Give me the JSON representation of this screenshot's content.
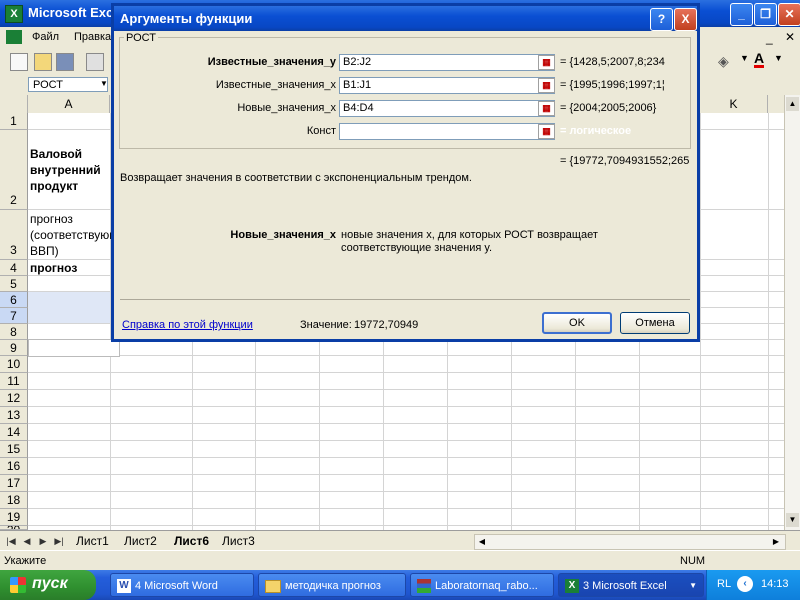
{
  "excel": {
    "title": "Microsoft Excel",
    "app_icon": "X",
    "menu": [
      "Файл",
      "Правка"
    ],
    "name_box": "РОСТ",
    "columns": [
      "A",
      "K"
    ],
    "rows": [
      "1",
      "2",
      "3",
      "4",
      "5",
      "6",
      "7",
      "8",
      "9",
      "10",
      "11",
      "12",
      "13",
      "14",
      "15",
      "16",
      "17",
      "18",
      "19",
      "20"
    ],
    "cells": {
      "a2": "Валовой внутренний продукт",
      "a3": "прогноз (соответствующий ВВП)",
      "a4": "прогноз"
    },
    "sheet_tabs": [
      "Лист1",
      "Лист2",
      "Лист6",
      "Лист3"
    ],
    "active_sheet": "Лист6",
    "status": {
      "mode": "Укажите",
      "num": "NUM"
    }
  },
  "dialog": {
    "title": "Аргументы функции",
    "group": "РОСТ",
    "args": [
      {
        "label": "Известные_значения_y",
        "value": "B2:J2",
        "result": "= {1428,5;2007,8;234",
        "bold": true
      },
      {
        "label": "Известные_значения_x",
        "value": "B1:J1",
        "result": "= {1995;1996;1997;1¦"
      },
      {
        "label": "Новые_значения_x",
        "value": "B4:D4",
        "result": "= {2004;2005;2006}"
      },
      {
        "label": "Конст",
        "value": "",
        "result": "= логическое"
      }
    ],
    "formula_result": "= {19772,7094931552;265",
    "description": "Возвращает значения в соответствии с экспоненциальным трендом.",
    "arg_help_name": "Новые_значения_x",
    "arg_help_text_1": "новые значения x, для которых РОСТ возвращает",
    "arg_help_text_2": "соответствующие значения y.",
    "help_link": "Справка по этой функции",
    "value_label": "Значение:",
    "value": "19772,70949",
    "ok": "OK",
    "cancel": "Отмена",
    "help_btn": "?",
    "close_btn": "X"
  },
  "taskbar": {
    "start": "пуск",
    "tasks": [
      {
        "label": "4 Microsoft Word",
        "icon": "word-icon"
      },
      {
        "label": "методичка прогноз",
        "icon": "folder-icon"
      },
      {
        "label": "Laboratornaq_rabo...",
        "icon": "rar-icon"
      },
      {
        "label": "3 Microsoft Excel",
        "icon": "excel-icon"
      }
    ],
    "lang": "RL",
    "clock": "14:13"
  }
}
